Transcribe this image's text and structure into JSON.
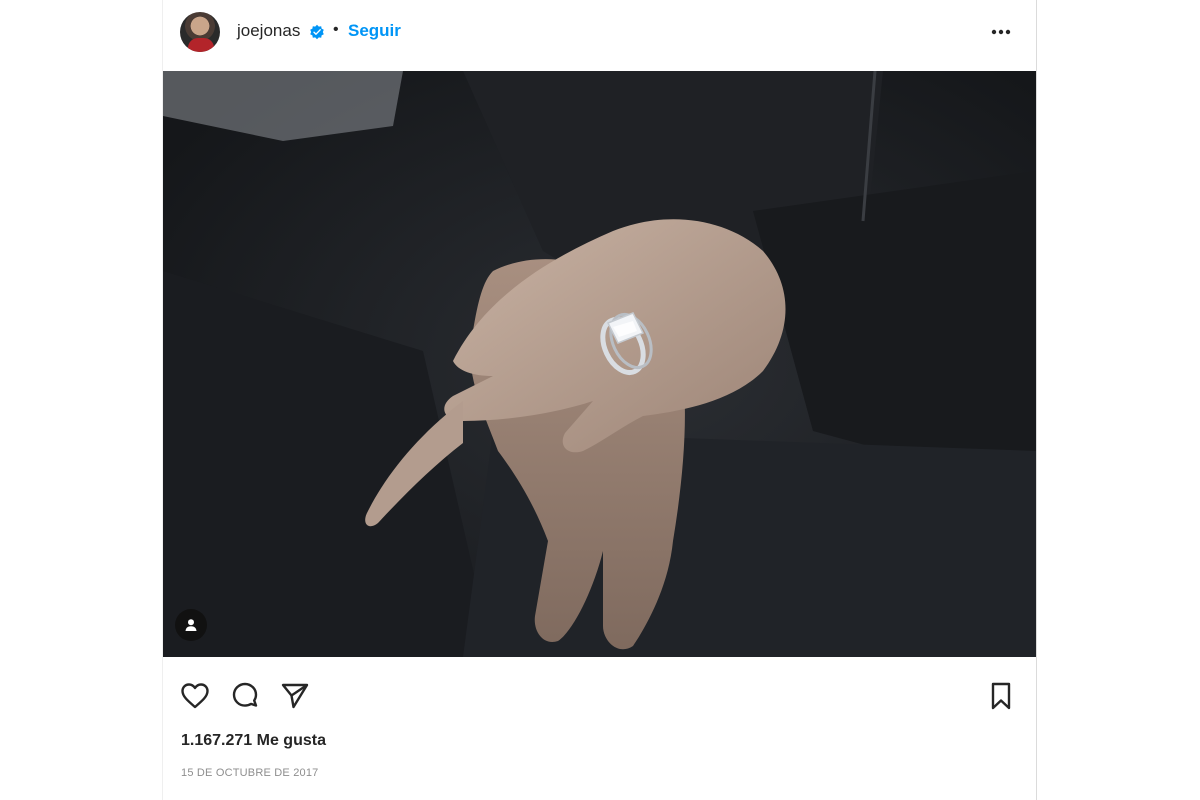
{
  "header": {
    "username": "joejonas",
    "separator": "•",
    "follow_label": "Seguir",
    "icons": {
      "verified": "verified-badge-icon",
      "more": "more-options-icon"
    }
  },
  "photo": {
    "icons": {
      "tagged_users": "user-tag-icon"
    }
  },
  "actions": {
    "icons": [
      "heart-icon",
      "comment-icon",
      "share-icon",
      "bookmark-icon"
    ]
  },
  "likes_text": "1.167.271 Me gusta",
  "date_text": "15 DE OCTUBRE DE 2017",
  "colors": {
    "accent": "#0095f6",
    "text": "#262626",
    "muted": "#8e8e8e"
  }
}
